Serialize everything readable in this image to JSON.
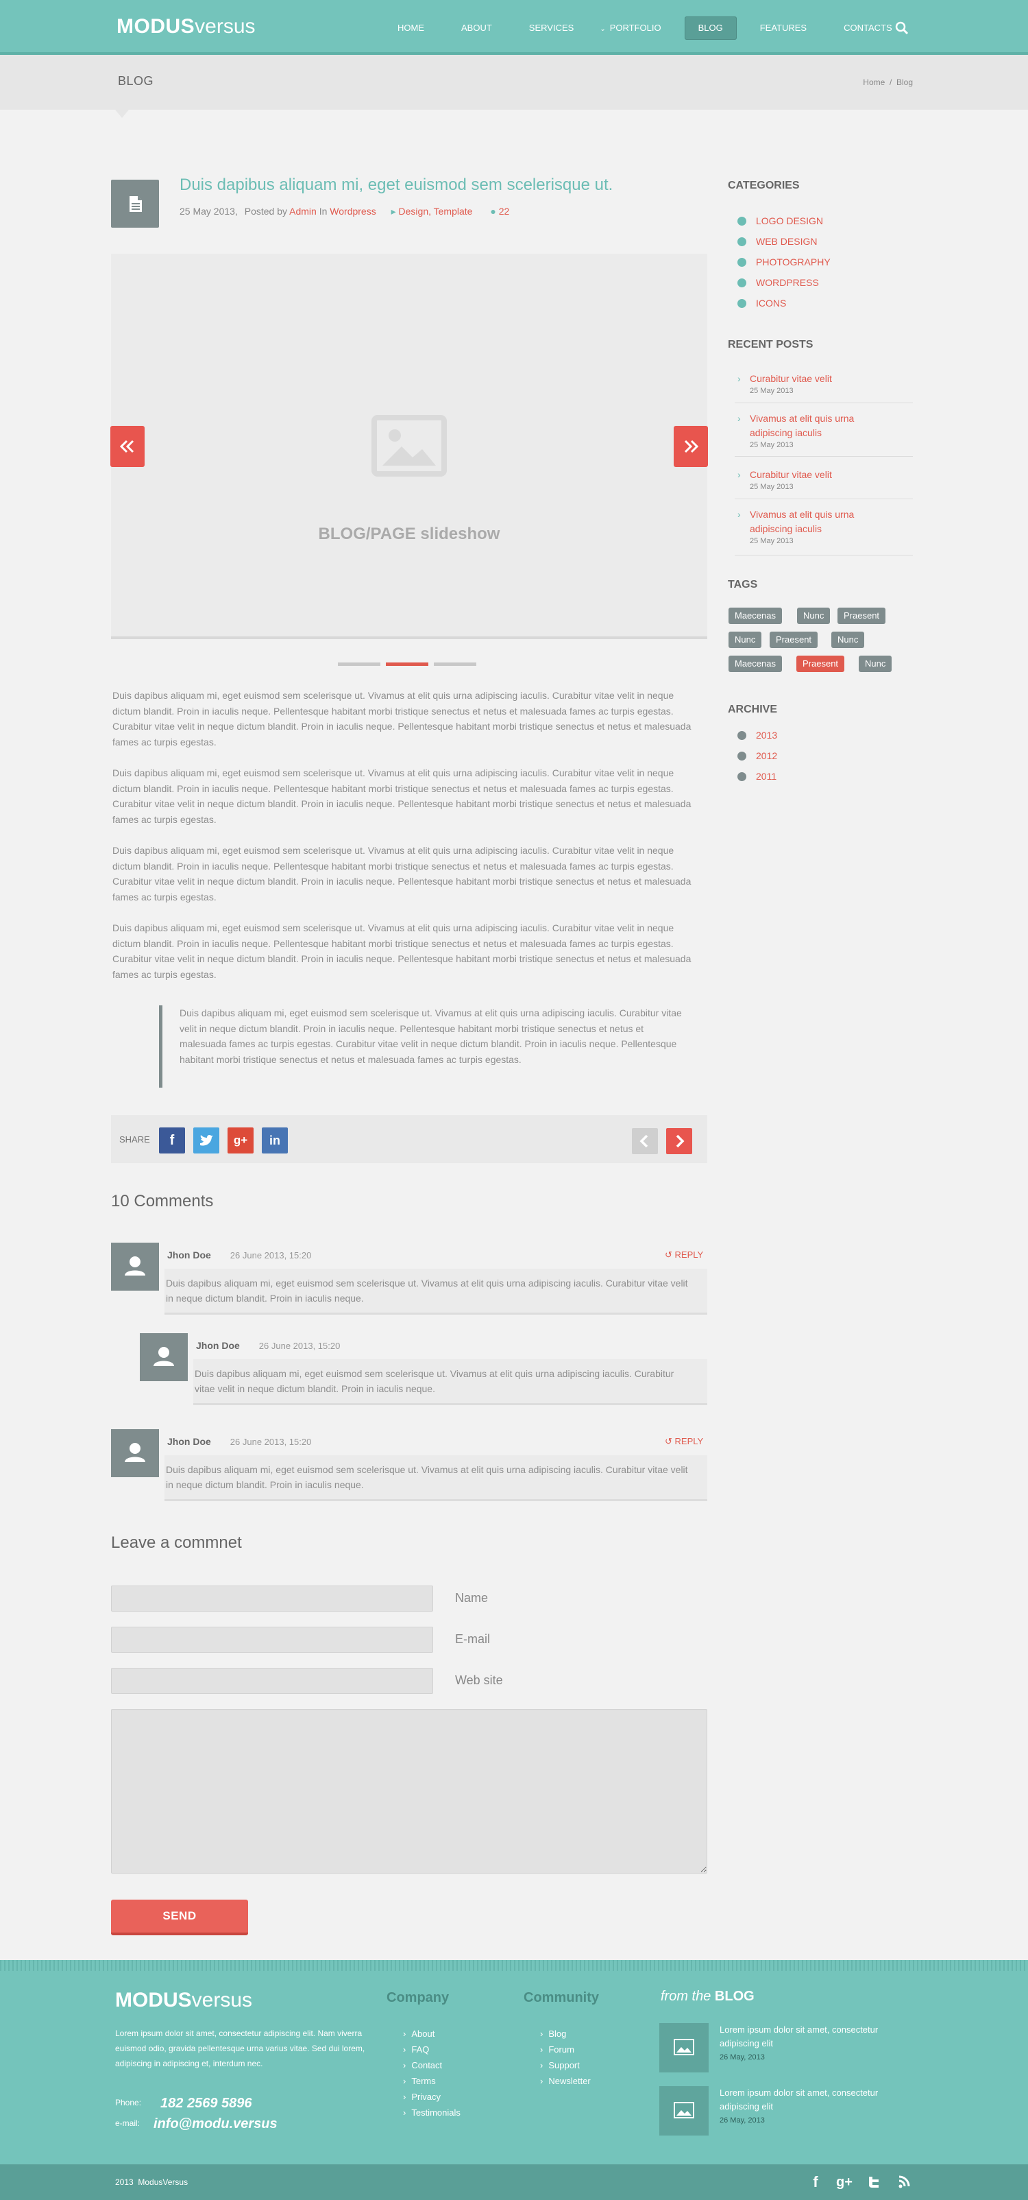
{
  "header": {
    "logo_bold": "MODUS",
    "logo_light": "versus",
    "nav": [
      {
        "label": "HOME"
      },
      {
        "label": "ABOUT"
      },
      {
        "label": "SERVICES"
      },
      {
        "label": "PORTFOLIO"
      },
      {
        "label": "BLOG"
      },
      {
        "label": "FEATURES"
      },
      {
        "label": "CONTACTS"
      }
    ],
    "active": "BLOG"
  },
  "titlebar": {
    "title": "BLOG",
    "breadcrumb": "Home  /  Blog"
  },
  "post": {
    "title": "Duis dapibus aliquam mi, eget euismod sem scelerisque ut.",
    "date": "25 May 2013,",
    "posted_by": "Posted by",
    "author": "Admin",
    "in": "In",
    "category": "Wordpress",
    "tags_comma": "Design, Template",
    "comment_count": "22",
    "slideshow_label": "BLOG/PAGE slideshow",
    "paragraphs": [
      "Duis dapibus aliquam mi, eget euismod sem scelerisque ut. Vivamus at elit quis urna adipiscing iaculis. Curabitur vitae velit in neque dictum blandit. Proin in iaculis neque. Pellentesque habitant morbi tristique senectus et netus et malesuada fames ac turpis egestas. Curabitur vitae velit in neque dictum blandit. Proin in iaculis neque. Pellentesque habitant morbi tristique senectus et netus et malesuada fames ac turpis egestas.",
      "Duis dapibus aliquam mi, eget euismod sem scelerisque ut. Vivamus at elit quis urna adipiscing iaculis. Curabitur vitae velit in neque dictum blandit. Proin in iaculis neque. Pellentesque habitant morbi tristique senectus et netus et malesuada fames ac turpis egestas. Curabitur vitae velit in neque dictum blandit. Proin in iaculis neque. Pellentesque habitant morbi tristique senectus et netus et malesuada fames ac turpis egestas.",
      "Duis dapibus aliquam mi, eget euismod sem scelerisque ut. Vivamus at elit quis urna adipiscing iaculis. Curabitur vitae velit in neque dictum blandit. Proin in iaculis neque. Pellentesque habitant morbi tristique senectus et netus et malesuada fames ac turpis egestas. Curabitur vitae velit in neque dictum blandit. Proin in iaculis neque. Pellentesque habitant morbi tristique senectus et netus et malesuada fames ac turpis egestas.",
      "Duis dapibus aliquam mi, eget euismod sem scelerisque ut. Vivamus at elit quis urna adipiscing iaculis. Curabitur vitae velit in neque dictum blandit. Proin in iaculis neque. Pellentesque habitant morbi tristique senectus et netus et malesuada fames ac turpis egestas. Curabitur vitae velit in neque dictum blandit. Proin in iaculis neque. Pellentesque habitant morbi tristique senectus et netus et malesuada fames ac turpis egestas."
    ],
    "quote": "Duis dapibus aliquam mi, eget euismod sem scelerisque ut. Vivamus at elit quis urna adipiscing iaculis. Curabitur vitae velit in neque dictum blandit. Proin in iaculis neque. Pellentesque habitant morbi tristique senectus et netus et malesuada fames ac turpis egestas. Curabitur vitae velit in neque dictum blandit. Proin in iaculis neque. Pellentesque habitant morbi tristique senectus et netus et malesuada fames ac turpis egestas.",
    "share_label": "SHARE"
  },
  "comments": {
    "title": "10 Comments",
    "reply_label": "REPLY",
    "items": [
      {
        "name": "Jhon Doe",
        "date": "26 June 2013, 15:20",
        "text": "Duis dapibus aliquam mi, eget euismod sem scelerisque ut. Vivamus at elit quis urna adipiscing iaculis. Curabitur vitae velit in neque dictum blandit. Proin in iaculis neque."
      },
      {
        "name": "Jhon Doe",
        "date": "26 June 2013, 15:20",
        "text": "Duis dapibus aliquam mi, eget euismod sem scelerisque ut. Vivamus at elit quis urna adipiscing iaculis. Curabitur vitae velit in neque dictum blandit. Proin in iaculis neque."
      },
      {
        "name": "Jhon Doe",
        "date": "26 June 2013, 15:20",
        "text": "Duis dapibus aliquam mi, eget euismod sem scelerisque ut. Vivamus at elit quis urna adipiscing iaculis. Curabitur vitae velit in neque dictum blandit. Proin in iaculis neque."
      }
    ]
  },
  "form": {
    "title": "Leave a commnet",
    "name_label": "Name",
    "email_label": "E-mail",
    "website_label": "Web site",
    "name_value": "",
    "email_value": "",
    "website_value": "",
    "message_value": "",
    "send_label": "SEND"
  },
  "sidebar": {
    "categories_title": "CATEGORIES",
    "categories": [
      "LOGO DESIGN",
      "WEB DESIGN",
      "PHOTOGRAPHY",
      "WORDPRESS",
      "ICONS"
    ],
    "recent_title": "RECENT POSTS",
    "recent": [
      {
        "title": "Curabitur vitae velit",
        "date": "25 May 2013"
      },
      {
        "title": "Vivamus at elit quis urna adipiscing iaculis",
        "date": "25 May 2013"
      },
      {
        "title": "Curabitur vitae velit",
        "date": "25 May 2013"
      },
      {
        "title": "Vivamus at elit quis urna adipiscing iaculis",
        "date": "25 May 2013"
      }
    ],
    "tags_title": "TAGS",
    "tags": [
      "Maecenas",
      "Nunc",
      "Praesent",
      "Nunc",
      "Praesent",
      "Nunc",
      "Maecenas",
      "Praesent",
      "Nunc"
    ],
    "active_tag_index": 7,
    "archive_title": "ARCHIVE",
    "archive": [
      "2013",
      "2012",
      "2011"
    ]
  },
  "footer": {
    "logo_bold": "MODUS",
    "logo_light": "versus",
    "about": "Lorem ipsum dolor sit amet, consectetur adipiscing elit. Nam viverra euismod odio, gravida pellentesque urna varius vitae. Sed dui lorem, adipiscing in adipiscing et, interdum nec.",
    "phone_label": "Phone:",
    "phone": "182 2569 5896",
    "email_label": "e-mail:",
    "email": "info@modu.versus",
    "company_title": "Company",
    "company_links": [
      "About",
      "FAQ",
      "Contact",
      "Terms",
      "Privacy",
      "Testimonials"
    ],
    "community_title": "Community",
    "community_links": [
      "Blog",
      "Forum",
      "Support",
      "Newsletter"
    ],
    "blog_title_italic": "from the",
    "blog_title_bold": "BLOG",
    "blog_posts": [
      {
        "title": "Lorem ipsum dolor sit amet, consectetur adipiscing elit",
        "date": "26 May, 2013"
      },
      {
        "title": "Lorem ipsum dolor sit amet, consectetur adipiscing elit",
        "date": "26 May, 2013"
      }
    ],
    "copyright": "2013  ModusVersus"
  },
  "colors": {
    "teal": "#74c4bb",
    "red": "#e05a4e",
    "slate": "#7f8c8d",
    "background": "#f2f2f2"
  },
  "icons": [
    "search-icon",
    "document-icon",
    "tag-icon",
    "comment-icon",
    "image-placeholder-icon",
    "double-chevron-left-icon",
    "double-chevron-right-icon",
    "facebook-icon",
    "twitter-icon",
    "google-plus-icon",
    "linkedin-icon",
    "chevron-left-icon",
    "chevron-right-icon",
    "user-icon",
    "reply-icon",
    "rss-icon"
  ]
}
